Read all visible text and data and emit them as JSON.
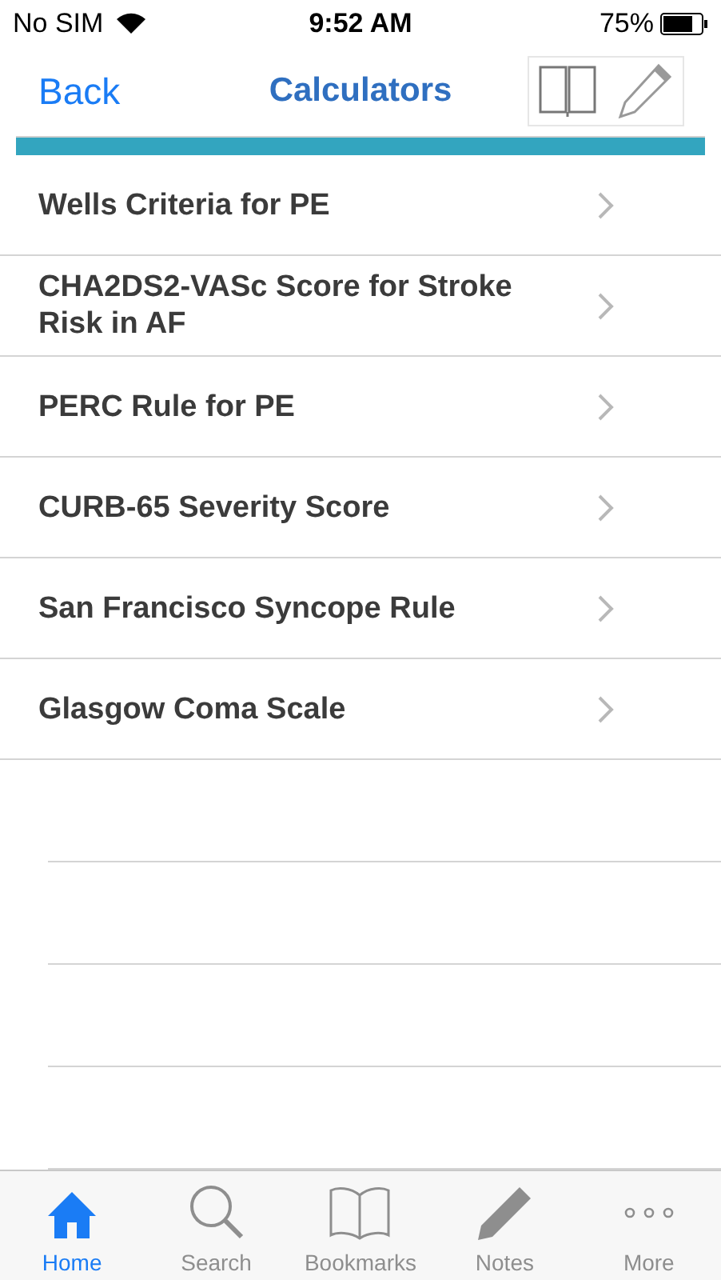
{
  "status_bar": {
    "carrier": "No SIM",
    "time": "9:52 AM",
    "battery": "75%"
  },
  "nav_bar": {
    "back": "Back",
    "title": "Calculators"
  },
  "items": [
    {
      "label": "Wells Criteria for PE"
    },
    {
      "label": "CHA2DS2-VASc Score for Stroke Risk in AF"
    },
    {
      "label": "PERC Rule for PE"
    },
    {
      "label": "CURB-65 Severity Score"
    },
    {
      "label": "San Francisco Syncope Rule"
    },
    {
      "label": "Glasgow Coma Scale"
    }
  ],
  "tab_bar": [
    {
      "kind": "home",
      "label": "Home",
      "selected": true
    },
    {
      "kind": "search",
      "label": "Search",
      "selected": false
    },
    {
      "kind": "bookmarks",
      "label": "Bookmarks",
      "selected": false
    },
    {
      "kind": "notes",
      "label": "Notes",
      "selected": false
    },
    {
      "kind": "more",
      "label": "More",
      "selected": false
    }
  ]
}
